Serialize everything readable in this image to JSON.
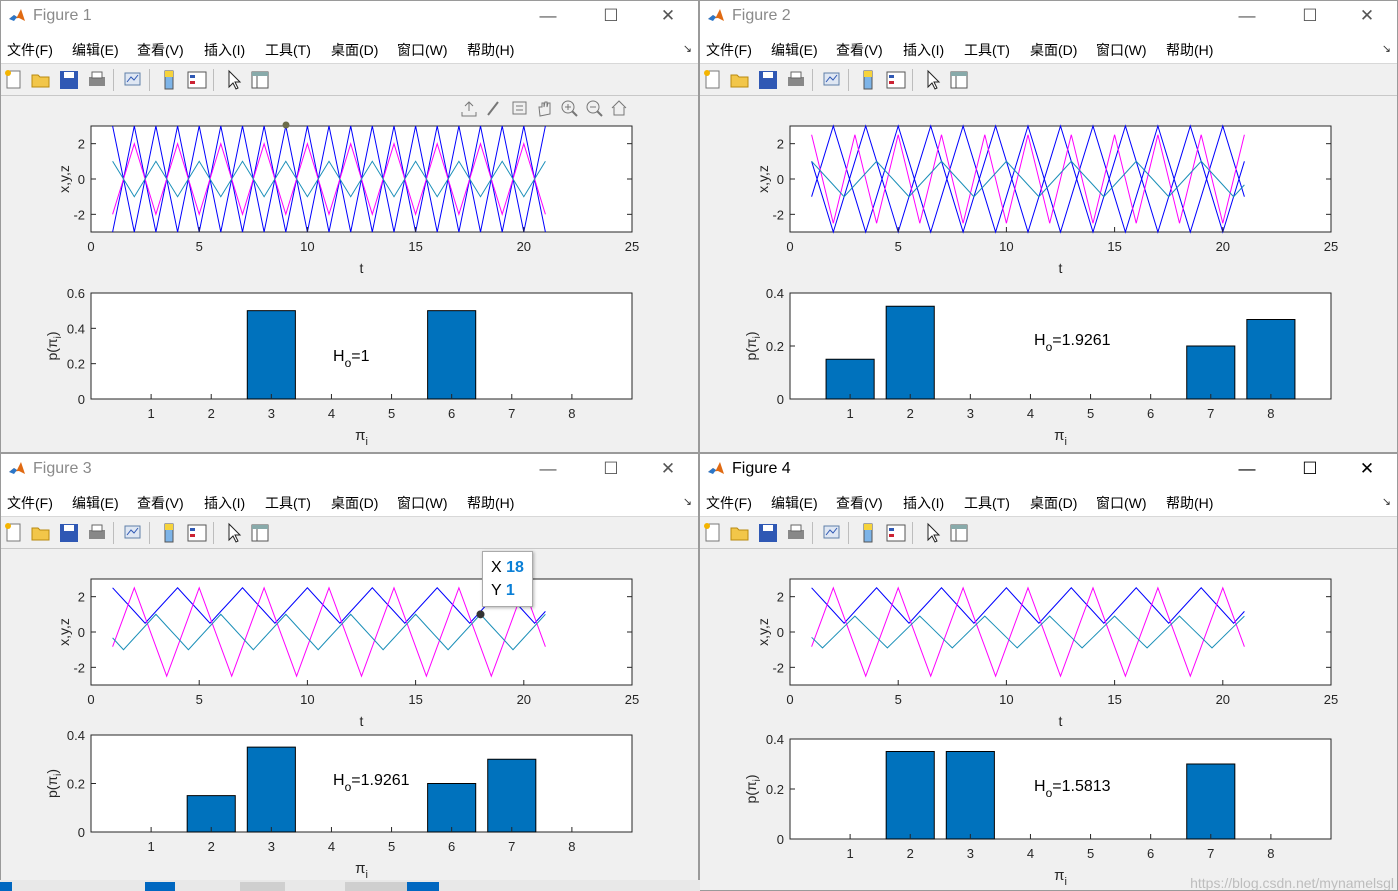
{
  "menu": [
    "文件(F)",
    "编辑(E)",
    "查看(V)",
    "插入(I)",
    "工具(T)",
    "桌面(D)",
    "窗口(W)",
    "帮助(H)"
  ],
  "window_buttons": {
    "minimize": "—",
    "maximize": "☐",
    "close": "✕"
  },
  "top_axes": {
    "ylabel": "x,y,z",
    "xlabel": "t",
    "xticks": [
      "0",
      "5",
      "10",
      "15",
      "20",
      "25"
    ]
  },
  "bottom_axes": {
    "ylabel": "p(π",
    "ylabel_sub": "i",
    "ylabel_close": ")",
    "xlabel": "π",
    "xlabel_sub": "i",
    "xticks": [
      "1",
      "2",
      "3",
      "4",
      "5",
      "6",
      "7",
      "8"
    ]
  },
  "colors": {
    "x": "#ff00ff",
    "y": "#0000ff",
    "z": "#1a8fb8",
    "bar": "#0072bd"
  },
  "figures": [
    {
      "title": "Figure 1",
      "active": false,
      "top_yticks": [
        "2",
        "0",
        "-2"
      ],
      "bottom_yticks": [
        "0.6",
        "0.4",
        "0.2",
        "0"
      ],
      "annotation": {
        "H": "H",
        "sub": "o",
        "value": "=1"
      },
      "chart_data": {
        "type": "bar",
        "categories": [
          1,
          2,
          3,
          4,
          5,
          6,
          7,
          8
        ],
        "values": [
          0,
          0,
          0.5,
          0,
          0,
          0.5,
          0,
          0
        ],
        "ylim": [
          0,
          0.6
        ]
      }
    },
    {
      "title": "Figure 2",
      "active": false,
      "top_yticks": [
        "2",
        "0",
        "-2"
      ],
      "bottom_yticks": [
        "0.4",
        "0.2",
        "0"
      ],
      "annotation": {
        "H": "H",
        "sub": "o",
        "value": "=1.9261"
      },
      "chart_data": {
        "type": "bar",
        "categories": [
          1,
          2,
          3,
          4,
          5,
          6,
          7,
          8
        ],
        "values": [
          0.15,
          0.35,
          0,
          0,
          0,
          0,
          0.2,
          0.3
        ],
        "ylim": [
          0,
          0.4
        ]
      }
    },
    {
      "title": "Figure 3",
      "active": false,
      "top_yticks": [
        "2",
        "0",
        "-2"
      ],
      "bottom_yticks": [
        "0.4",
        "0.2",
        "0"
      ],
      "annotation": {
        "H": "H",
        "sub": "o",
        "value": "=1.9261"
      },
      "datatip": {
        "x_label": "X",
        "x_value": "18",
        "y_label": "Y",
        "y_value": "1"
      },
      "chart_data": {
        "type": "bar",
        "categories": [
          1,
          2,
          3,
          4,
          5,
          6,
          7,
          8
        ],
        "values": [
          0,
          0.15,
          0.35,
          0,
          0,
          0.2,
          0.3,
          0
        ],
        "ylim": [
          0,
          0.4
        ]
      }
    },
    {
      "title": "Figure 4",
      "active": true,
      "top_yticks": [
        "2",
        "0",
        "-2"
      ],
      "bottom_yticks": [
        "0.4",
        "0.2",
        "0"
      ],
      "annotation": {
        "H": "H",
        "sub": "o",
        "value": "=1.5813"
      },
      "chart_data": {
        "type": "bar",
        "categories": [
          1,
          2,
          3,
          4,
          5,
          6,
          7,
          8
        ],
        "values": [
          0,
          0.35,
          0.35,
          0,
          0,
          0,
          0.3,
          0
        ],
        "ylim": [
          0,
          0.4
        ]
      }
    }
  ],
  "watermark": "https://blog.csdn.net/mynamelsgl"
}
